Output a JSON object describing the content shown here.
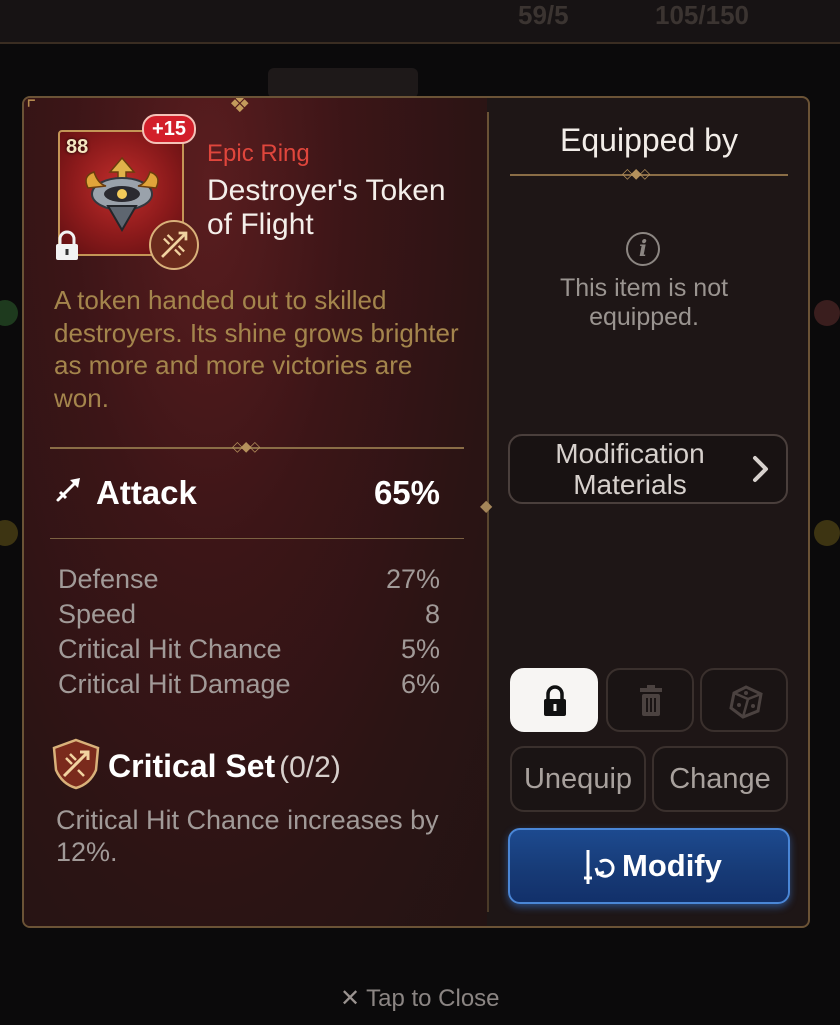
{
  "background": {
    "resource_1": "59/5",
    "resource_2": "105/150"
  },
  "item": {
    "level": "88",
    "enhance": "+15",
    "rarity": "Epic Ring",
    "name": "Destroyer's Token of Flight",
    "description": "A token handed out to skilled destroyers. Its shine grows brighter as more and more victories are won."
  },
  "main_stat": {
    "label": "Attack",
    "value": "65%"
  },
  "substats": [
    {
      "label": "Defense",
      "value": "27%"
    },
    {
      "label": "Speed",
      "value": "8"
    },
    {
      "label": "Critical Hit Chance",
      "value": "5%"
    },
    {
      "label": "Critical Hit Damage",
      "value": "6%"
    }
  ],
  "set": {
    "name": "Critical Set",
    "count": "(0/2)",
    "description": "Critical Hit Chance increases by 12%."
  },
  "equipped": {
    "title": "Equipped by",
    "status": "This item is not equipped."
  },
  "buttons": {
    "modification_materials": "Modification Materials",
    "unequip": "Unequip",
    "change": "Change",
    "modify": "Modify"
  },
  "footer": {
    "tap_close": "Tap to Close"
  },
  "colors": {
    "rarity": "#e0463c",
    "accent_gold": "#a4854c",
    "modify_blue": "#1d4a8f",
    "enhance_badge": "#d21f2a"
  }
}
